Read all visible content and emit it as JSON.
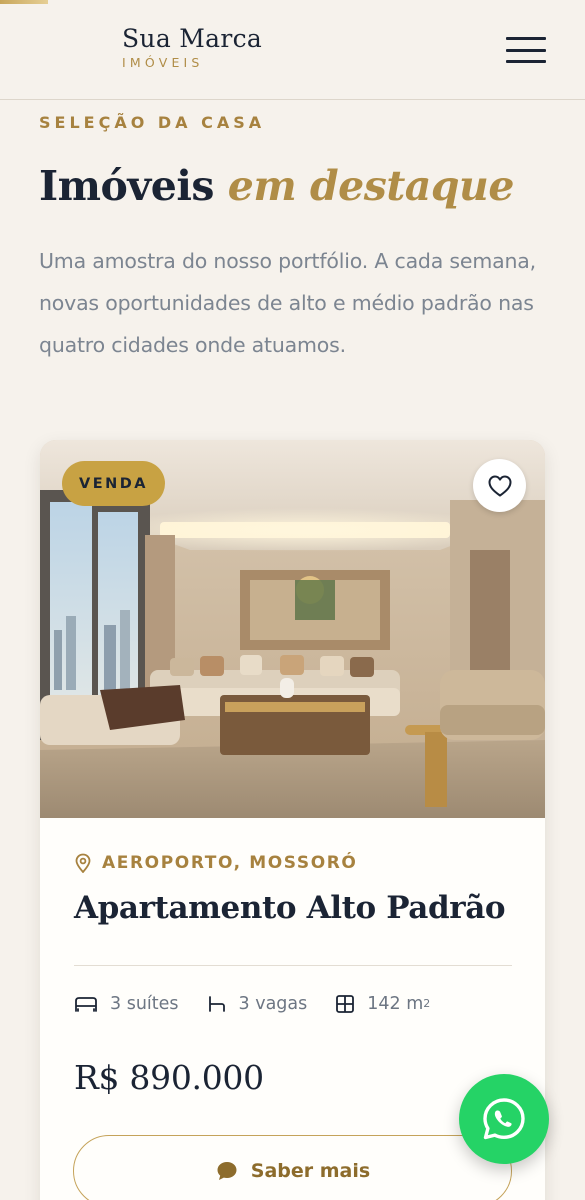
{
  "header": {
    "brand_name": "Sua Marca",
    "brand_subtitle": "IMÓVEIS",
    "menu_icon": "hamburger-menu-icon"
  },
  "section": {
    "eyebrow": "SELEÇÃO DA CASA",
    "title_plain": "Imóveis",
    "title_accent": "em destaque",
    "description": "Uma amostra do nosso portfólio. A cada semana, novas oportunidades de alto e médio padrão nas quatro cidades onde atuamos."
  },
  "property": {
    "badge": "VENDA",
    "favorite_icon": "heart-icon",
    "location_icon": "map-pin-icon",
    "location": "AEROPORTO, MOSSORÓ",
    "title": "Apartamento Alto Padrão",
    "features": [
      {
        "icon": "bed-icon",
        "label": "3 suítes"
      },
      {
        "icon": "car-seat-icon",
        "label": "3 vagas"
      },
      {
        "icon": "area-grid-icon",
        "label": "142 m",
        "unit_sup": "2"
      }
    ],
    "price": "R$ 890.000",
    "cta_label": "Saber mais",
    "cta_icon": "chat-bubble-icon"
  },
  "floating": {
    "whatsapp_icon": "whatsapp-icon"
  },
  "colors": {
    "background": "#f6f2ec",
    "navy": "#1b2434",
    "gold": "#b08d47",
    "badge_gold": "#c8a243",
    "whatsapp_green": "#25d366"
  }
}
